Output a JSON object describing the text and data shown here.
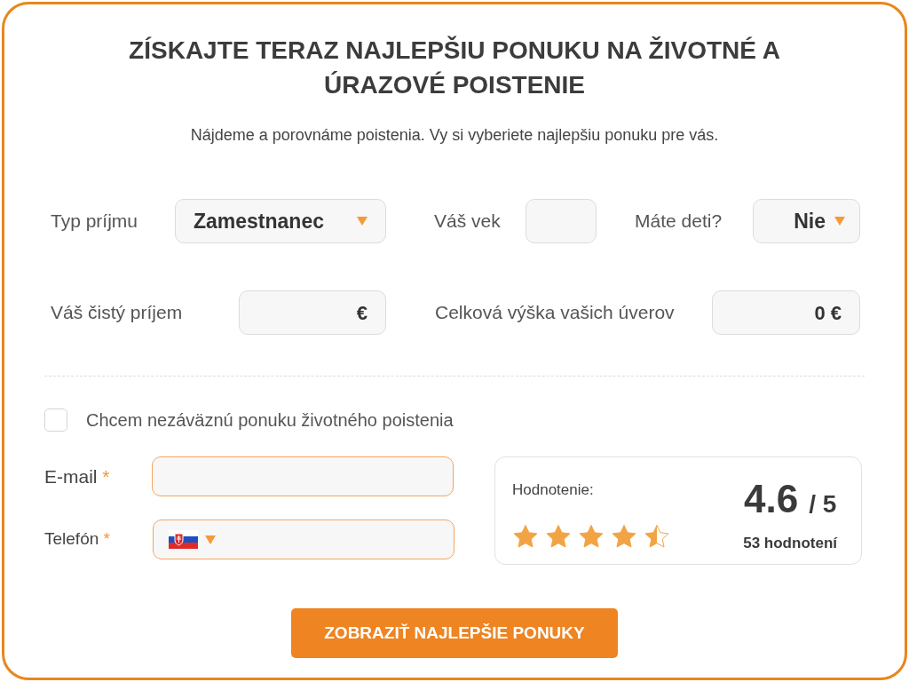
{
  "title": "ZÍSKAJTE TERAZ NAJLEPŠIU PONUKU NA ŽIVOTNÉ A ÚRAZOVÉ POISTENIE",
  "subtitle": "Nájdeme a porovnáme poistenia. Vy si vyberiete najlepšiu ponuku pre vás.",
  "income_type": {
    "label": "Typ príjmu",
    "value": "Zamestnanec"
  },
  "age": {
    "label": "Váš vek"
  },
  "children": {
    "label": "Máte deti?",
    "value": "Nie"
  },
  "net_income": {
    "label": "Váš čistý príjem",
    "suffix": "€"
  },
  "loans": {
    "label": "Celková výška vašich úverov",
    "value": "0 €"
  },
  "life_insurance": {
    "label": "Chcem nezáväznú ponuku životného poistenia",
    "checked": false
  },
  "email": {
    "label": "E-mail",
    "required": "*"
  },
  "phone": {
    "label": "Telefón",
    "required": "*"
  },
  "rating": {
    "label": "Hodnotenie:",
    "score": "4.6",
    "max": "/ 5",
    "count": "53 hodnotení",
    "stars": 4.5
  },
  "submit": "ZOBRAZIŤ NAJLEPŠIE PONUKY"
}
